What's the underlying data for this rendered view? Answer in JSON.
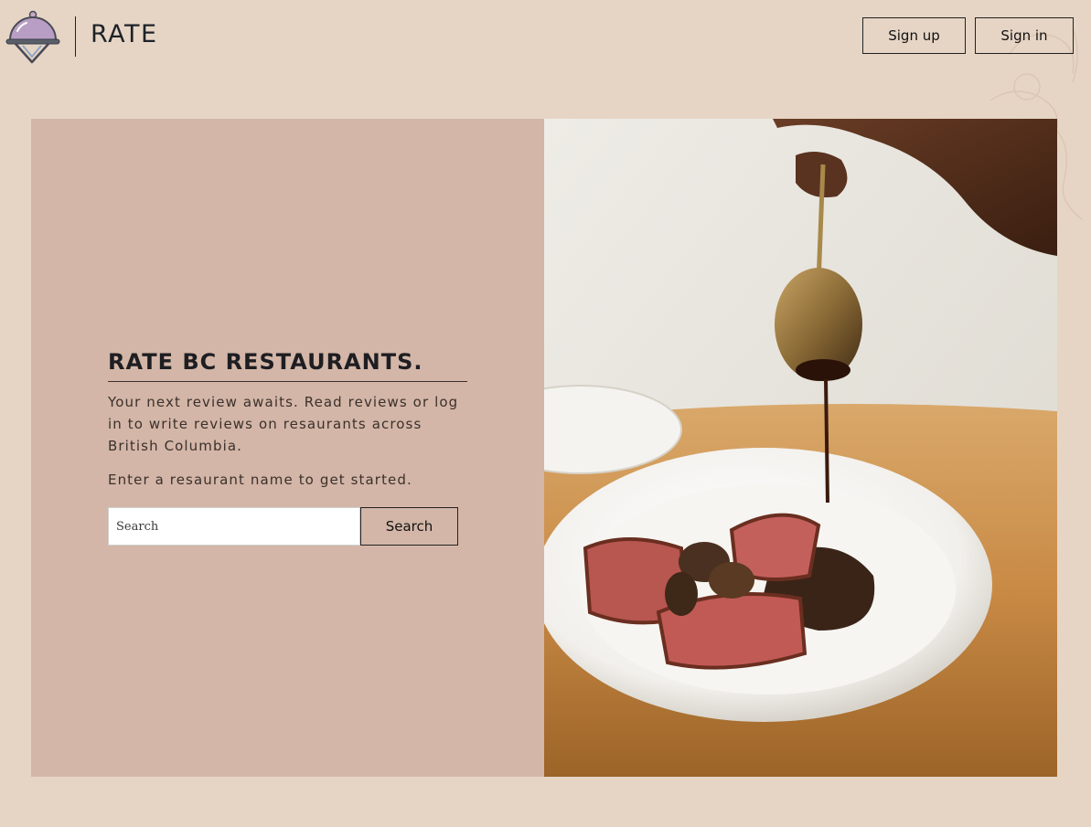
{
  "header": {
    "brand": "RATE",
    "signup_label": "Sign up",
    "signin_label": "Sign in",
    "logo_icon": "food-cloche-icon"
  },
  "hero": {
    "title": "RATE BC RESTAURANTS.",
    "description": "Your next review awaits. Read reviews or log in to write reviews on resaurants across British Columbia.",
    "hint": "Enter a resaurant name to get started.",
    "search_placeholder": "Search",
    "search_button_label": "Search",
    "image": "plated-steak-with-sauce-photo"
  },
  "colors": {
    "page_background": "#e6d5c5",
    "panel_background": "#d3b6a7",
    "text": "#222222"
  }
}
